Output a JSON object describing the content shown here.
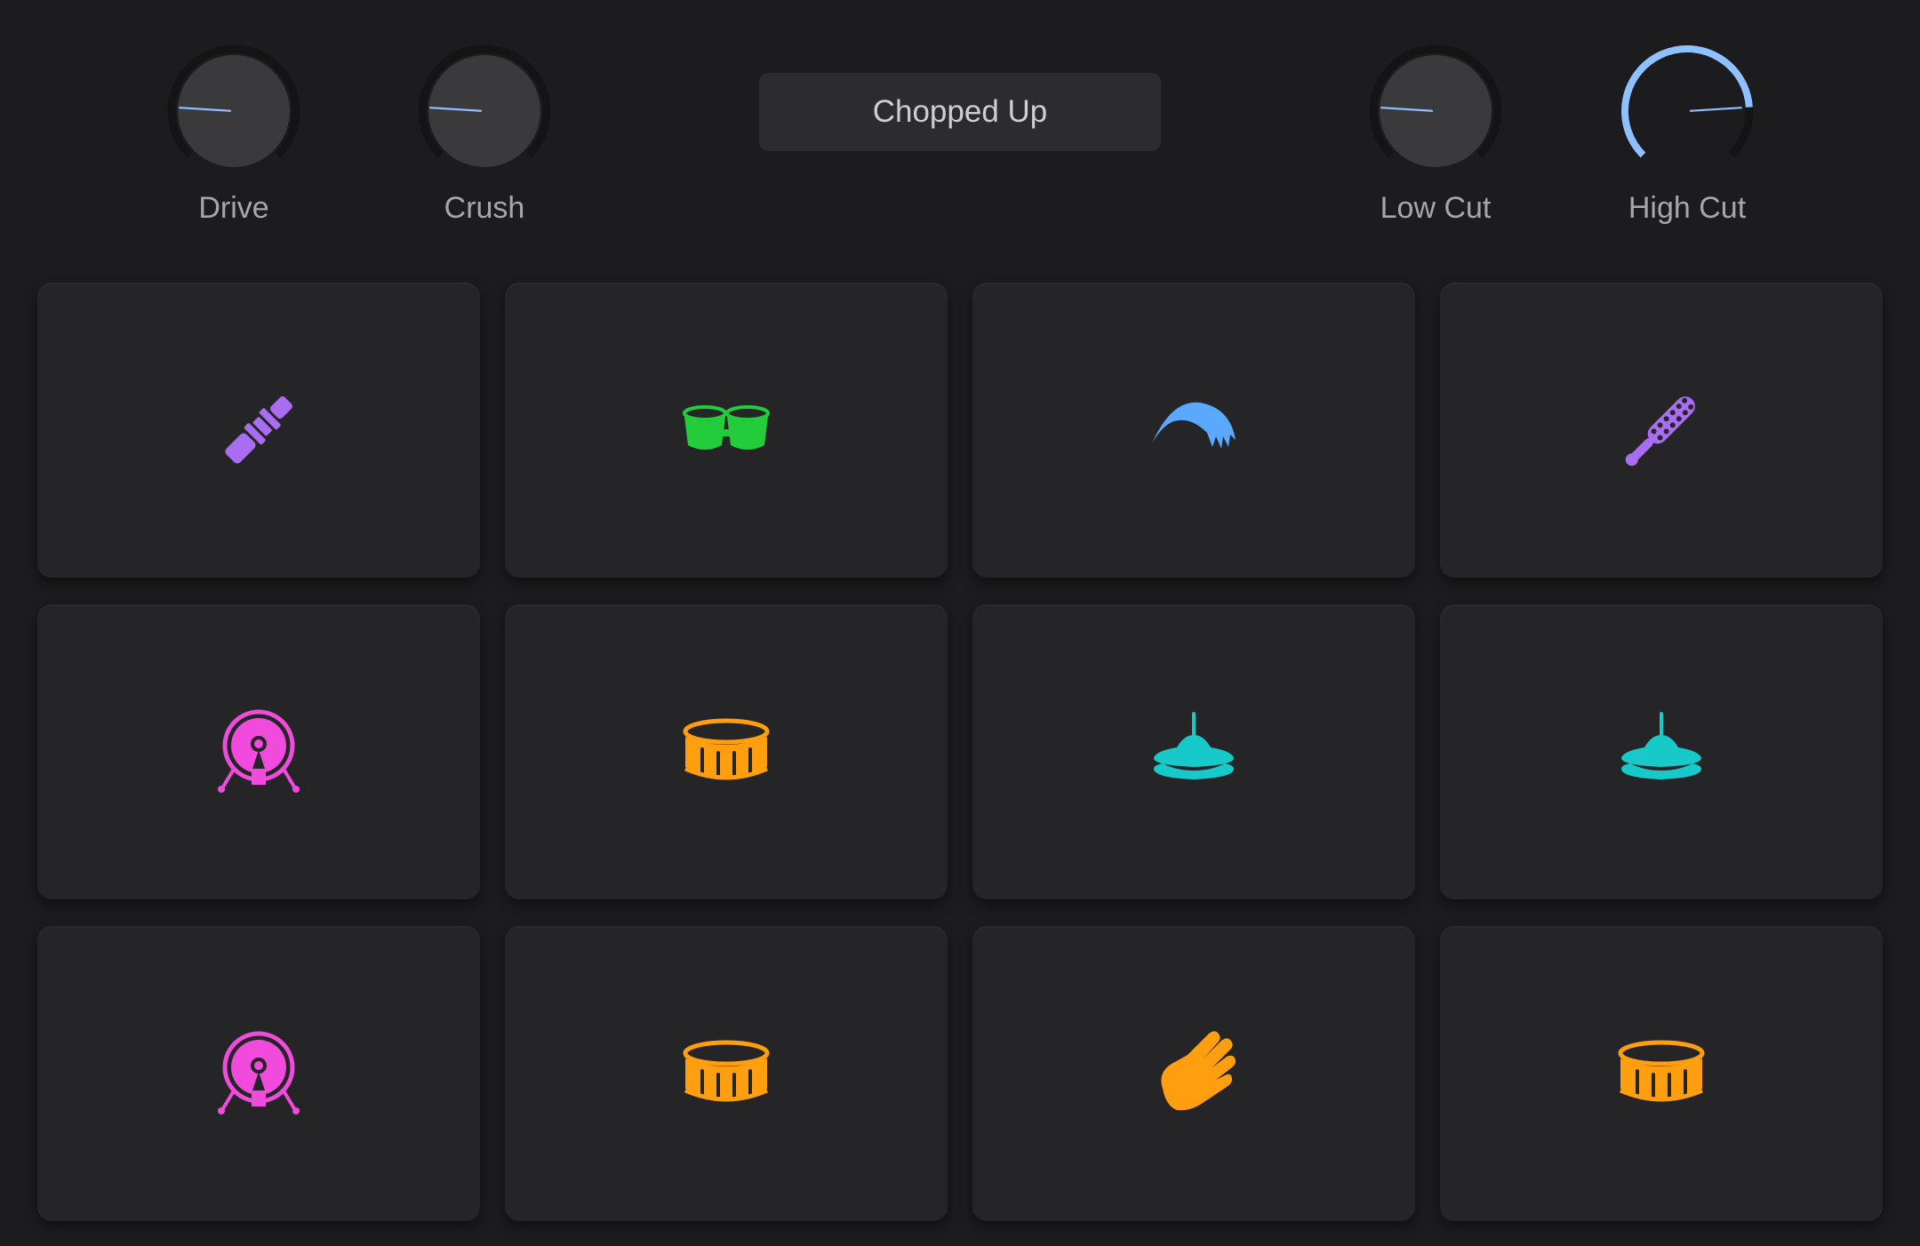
{
  "app": {
    "preset_name": "Chopped Up"
  },
  "knobs": [
    {
      "id": "drive",
      "label": "Drive",
      "value": 0.18,
      "active": false
    },
    {
      "id": "crush",
      "label": "Crush",
      "value": 0.18,
      "active": false
    },
    {
      "id": "lowcut",
      "label": "Low Cut",
      "value": 0.18,
      "active": false
    },
    {
      "id": "highcut",
      "label": "High Cut",
      "value": 0.82,
      "active": true
    }
  ],
  "pads": [
    {
      "icon": "clave-stick-icon",
      "color": "#a86df0"
    },
    {
      "icon": "bongo-icon",
      "color": "#22cc3a"
    },
    {
      "icon": "cymbal-swell-icon",
      "color": "#5aa9ff"
    },
    {
      "icon": "shaker-icon",
      "color": "#a86df0"
    },
    {
      "icon": "kick-drum-icon",
      "color": "#f04bdc"
    },
    {
      "icon": "snare-drum-icon",
      "color": "#ff9f10"
    },
    {
      "icon": "hi-hat-icon",
      "color": "#17c9c9"
    },
    {
      "icon": "hi-hat-icon",
      "color": "#17c9c9"
    },
    {
      "icon": "kick-drum-icon",
      "color": "#f04bdc"
    },
    {
      "icon": "snare-drum-icon",
      "color": "#ff9f10"
    },
    {
      "icon": "clap-hand-icon",
      "color": "#ff9f10"
    },
    {
      "icon": "snare-drum-icon",
      "color": "#ff9f10"
    }
  ],
  "colors": {
    "background": "#1c1c1e",
    "pad": "#252527",
    "knob_face": "#3a3a3c",
    "knob_indicator": "#8fc0ff",
    "knob_active_ring": "#8fc0ff"
  }
}
